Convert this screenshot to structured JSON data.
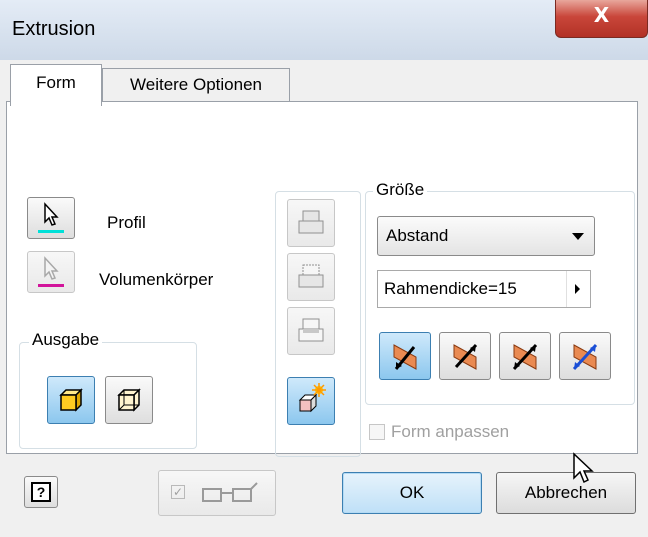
{
  "window": {
    "title": "Extrusion",
    "close_glyph": "X"
  },
  "tabs": [
    {
      "label": "Form",
      "active": true
    },
    {
      "label": "Weitere Optionen",
      "active": false
    }
  ],
  "form": {
    "profile_label": "Profil",
    "solid_label": "Volumenkörper",
    "output_group": "Ausgabe",
    "size_group": "Größe",
    "extent_value": "Abstand",
    "distance_value": "Rahmendicke=15",
    "match_shape_label": "Form anpassen"
  },
  "footer": {
    "help_label": "?",
    "ok_label": "OK",
    "cancel_label": "Abbrechen"
  },
  "colors": {
    "profile_accent": "#00e0d8",
    "solid_accent": "#d2149b",
    "selected_accent": "#3c7fb1"
  },
  "icons": [
    "arrow-cursor-icon",
    "solid-body-icon",
    "solid-output-icon",
    "surface-output-icon",
    "join-icon",
    "cut-icon",
    "intersect-icon",
    "new-solid-icon",
    "direction-default-icon",
    "direction-flipped-icon",
    "direction-symmetric-icon",
    "direction-asymmetric-icon",
    "help-icon",
    "preview-glasses-icon"
  ]
}
